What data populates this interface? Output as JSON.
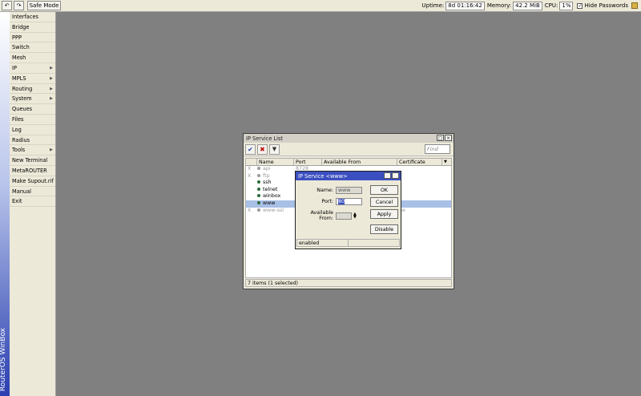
{
  "topbar": {
    "undo_icon": "undo-icon",
    "redo_icon": "redo-icon",
    "safe_mode_label": "Safe Mode",
    "uptime_label": "Uptime:",
    "uptime_value": "8d 01:16:42",
    "memory_label": "Memory:",
    "memory_value": "42.2 MiB",
    "cpu_label": "CPU:",
    "cpu_value": "1%",
    "hide_passwords_label": "Hide Passwords",
    "hide_passwords_checked": "✓"
  },
  "brand": {
    "text": "RouterOS WinBox"
  },
  "menu": {
    "items": [
      {
        "label": "Interfaces",
        "arrow": ""
      },
      {
        "label": "Bridge",
        "arrow": ""
      },
      {
        "label": "PPP",
        "arrow": ""
      },
      {
        "label": "Switch",
        "arrow": ""
      },
      {
        "label": "Mesh",
        "arrow": ""
      },
      {
        "label": "IP",
        "arrow": "▶"
      },
      {
        "label": "MPLS",
        "arrow": "▶"
      },
      {
        "label": "Routing",
        "arrow": "▶"
      },
      {
        "label": "System",
        "arrow": "▶"
      },
      {
        "label": "Queues",
        "arrow": ""
      },
      {
        "label": "Files",
        "arrow": ""
      },
      {
        "label": "Log",
        "arrow": ""
      },
      {
        "label": "Radius",
        "arrow": ""
      },
      {
        "label": "Tools",
        "arrow": "▶"
      },
      {
        "label": "New Terminal",
        "arrow": ""
      },
      {
        "label": "MetaROUTER",
        "arrow": ""
      },
      {
        "label": "Make Supout.rif",
        "arrow": ""
      },
      {
        "label": "Manual",
        "arrow": ""
      },
      {
        "label": "Exit",
        "arrow": ""
      }
    ]
  },
  "service_list": {
    "title": "IP Service List",
    "restore_glyph": "□",
    "close_glyph": "×",
    "enable_glyph": "✔",
    "disable_glyph": "✖",
    "filter_glyph": "▼",
    "find_placeholder": "Find",
    "columns": [
      "Name",
      "Port",
      "Available From",
      "Certificate"
    ],
    "rows": [
      {
        "flag": "X",
        "name": "api",
        "port": "8728",
        "from": "",
        "cert": "",
        "state": "dis"
      },
      {
        "flag": "X",
        "name": "ftp",
        "port": "",
        "from": "",
        "cert": "",
        "state": "dis"
      },
      {
        "flag": "",
        "name": "ssh",
        "port": "",
        "from": "",
        "cert": "",
        "state": ""
      },
      {
        "flag": "",
        "name": "telnet",
        "port": "",
        "from": "",
        "cert": "",
        "state": ""
      },
      {
        "flag": "",
        "name": "winbox",
        "port": "",
        "from": "",
        "cert": "",
        "state": ""
      },
      {
        "flag": "",
        "name": "www",
        "port": "",
        "from": "",
        "cert": "",
        "state": "sel"
      },
      {
        "flag": "X",
        "name": "www-ssl",
        "port": "",
        "from": "",
        "cert": "ne",
        "state": "dis"
      }
    ],
    "status": "7 items (1 selected)"
  },
  "dialog": {
    "title": "IP Service <www>",
    "name_label": "Name:",
    "name_value": "www",
    "port_label": "Port:",
    "port_value": "80",
    "available_from_label": "Available From:",
    "available_from_value": "",
    "ok_label": "OK",
    "cancel_label": "Cancel",
    "apply_label": "Apply",
    "disable_label": "Disable",
    "status": "enabled"
  },
  "colors": {
    "desktop": "#808080",
    "dialog_title": "#3b4fc0",
    "selected_row": "#a8bfe6"
  }
}
